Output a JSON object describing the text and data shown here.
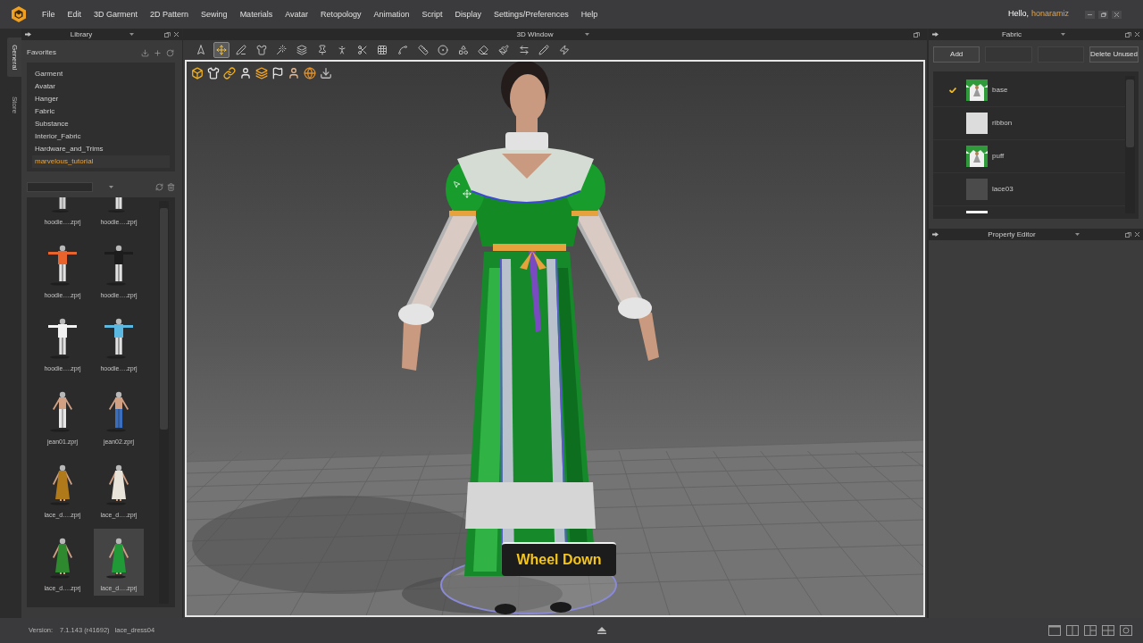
{
  "menu_bar": {
    "items": [
      "File",
      "Edit",
      "3D Garment",
      "2D Pattern",
      "Sewing",
      "Materials",
      "Avatar",
      "Retopology",
      "Animation",
      "Script",
      "Display",
      "Settings/Preferences",
      "Help"
    ],
    "greeting": "Hello,",
    "username": "honaramiz"
  },
  "side_tabs": [
    {
      "label": "General",
      "selected": true
    },
    {
      "label": "Store",
      "selected": false
    }
  ],
  "library": {
    "title": "Library",
    "favorites_label": "Favorites",
    "favorites": [
      {
        "label": "Garment",
        "selected": false
      },
      {
        "label": "Avatar",
        "selected": false
      },
      {
        "label": "Hanger",
        "selected": false
      },
      {
        "label": "Fabric",
        "selected": false
      },
      {
        "label": "Substance",
        "selected": false
      },
      {
        "label": "Interior_Fabric",
        "selected": false
      },
      {
        "label": "Hardware_and_Trims",
        "selected": false
      },
      {
        "label": "marvelous_tutorial",
        "selected": true
      }
    ],
    "items": [
      {
        "label": "hoodie….zprj",
        "kind": "pants",
        "color": "#d2d2d2",
        "selected": false
      },
      {
        "label": "hoodie….zprj",
        "kind": "pants",
        "color": "#e0e0e0",
        "selected": false
      },
      {
        "label": "hoodie….zprj",
        "kind": "top",
        "color": "#e8642c",
        "selected": false
      },
      {
        "label": "hoodie….zprj",
        "kind": "top",
        "color": "#1c1c1c",
        "selected": false
      },
      {
        "label": "hoodie….zprj",
        "kind": "top",
        "color": "#f2f2f2",
        "selected": false
      },
      {
        "label": "hoodie….zprj",
        "kind": "top",
        "color": "#5bb8e0",
        "selected": false
      },
      {
        "label": "jean01.zprj",
        "kind": "pants",
        "color": "#e6e6e6",
        "selected": false
      },
      {
        "label": "jean02.zprj",
        "kind": "pants",
        "color": "#3a6fc0",
        "selected": false
      },
      {
        "label": "lace_d….zprj",
        "kind": "dress",
        "color": "#b07a1a",
        "selected": false
      },
      {
        "label": "lace_d….zprj",
        "kind": "dress",
        "color": "#e8e4da",
        "selected": false
      },
      {
        "label": "lace_d….zprj",
        "kind": "dress",
        "color": "#2f8a2f",
        "selected": false
      },
      {
        "label": "lace_d….zprj",
        "kind": "dress",
        "color": "#1f9a36",
        "selected": true
      }
    ]
  },
  "viewport_3d": {
    "title": "3D Window",
    "tools": [
      {
        "selected": false
      },
      {
        "selected": true
      },
      {
        "selected": false
      },
      {
        "selected": false
      },
      {
        "selected": false
      },
      {
        "selected": false
      },
      {
        "selected": false
      },
      {
        "selected": false
      },
      {
        "selected": false
      },
      {
        "selected": false
      },
      {
        "selected": false
      },
      {
        "selected": false
      },
      {
        "selected": false
      },
      {
        "selected": false
      },
      {
        "selected": false
      },
      {
        "selected": false
      },
      {
        "selected": false
      },
      {
        "selected": false
      },
      {
        "selected": false
      }
    ],
    "overlay_caption": "Wheel Down"
  },
  "fabric": {
    "title": "Fabric",
    "buttons": [
      {
        "label": "Add",
        "disabled": false
      },
      {
        "disabled": true
      },
      {
        "disabled": true
      },
      {
        "label": "Delete Unused",
        "disabled": false
      }
    ],
    "items": [
      {
        "name": "base",
        "checked": true,
        "kind": "print"
      },
      {
        "name": "ribbon",
        "checked": false,
        "kind": "solid",
        "color": "#dcdcdc"
      },
      {
        "name": "puff",
        "checked": false,
        "kind": "print"
      },
      {
        "name": "lace03",
        "checked": false,
        "kind": "solid",
        "color": "#4b4b4b"
      },
      {
        "checked": false,
        "kind": "partial",
        "color": "#f2f2f2"
      }
    ]
  },
  "property_editor": {
    "title": "Property Editor"
  },
  "status_bar": {
    "version_label": "Version:",
    "version": "7.1.143 (r41692)",
    "file": "lace_dress04"
  }
}
